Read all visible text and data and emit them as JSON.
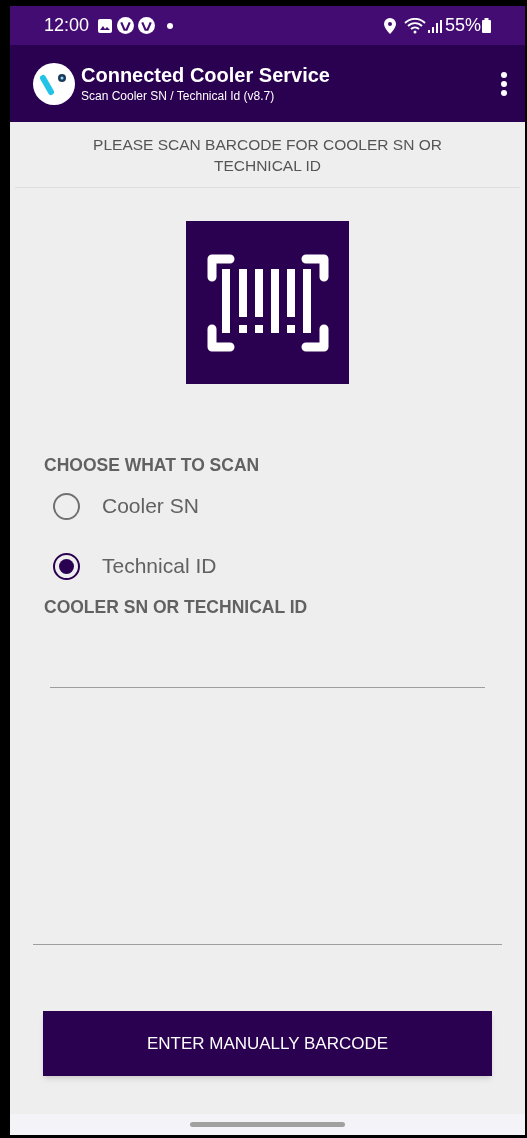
{
  "status_bar": {
    "time": "12:00",
    "battery_text": "55%"
  },
  "app_bar": {
    "title": "Connected Cooler Service",
    "subtitle": "Scan Cooler SN / Technical Id (v8.7)"
  },
  "instruction": "PLEASE SCAN BARCODE FOR COOLER SN OR TECHNICAL ID",
  "scan_type": {
    "heading": "CHOOSE WHAT TO SCAN",
    "options": [
      {
        "label": "Cooler SN",
        "selected": false
      },
      {
        "label": "Technical ID",
        "selected": true
      }
    ]
  },
  "code_field": {
    "label": "COOLER SN OR TECHNICAL ID"
  },
  "button": "ENTER MANUALLY BARCODE"
}
